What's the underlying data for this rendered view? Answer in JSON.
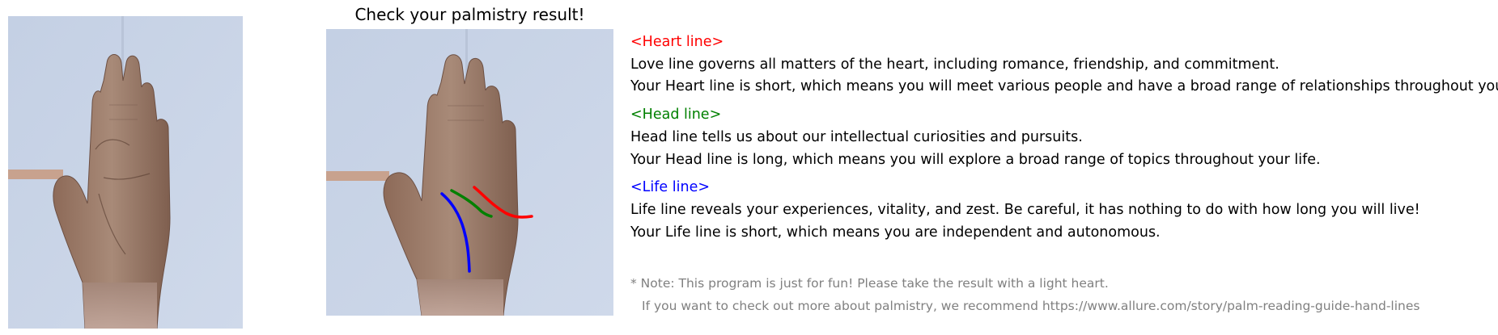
{
  "result_title": "Check your palmistry result!",
  "palm_lines": [
    {
      "name": "Heart line",
      "color": "#ff0000"
    },
    {
      "name": "Head line",
      "color": "#008000"
    },
    {
      "name": "Life line",
      "color": "#0000ff"
    }
  ],
  "sections": {
    "heart": {
      "heading": "<Heart line>",
      "description": "Love line governs all matters of the heart, including romance, friendship, and commitment.",
      "result": "Your Heart line is short, which means you will meet various people and have a broad range of relationships throughout your life.",
      "color": "#ff0000"
    },
    "head": {
      "heading": "<Head line>",
      "description": "Head line tells us about our intellectual curiosities and pursuits.",
      "result": "Your Head line is long, which means you will explore a broad range of topics throughout your life.",
      "color": "#008000"
    },
    "life": {
      "heading": "<Life line>",
      "description": "Life line reveals your experiences, vitality, and zest. Be careful, it has nothing to do with how long you will live!",
      "result": "Your Life line is short, which means you are independent and autonomous.",
      "color": "#0000ff"
    }
  },
  "note": {
    "line1": "* Note: This program is just for fun! Please take the result with a light heart.",
    "line2": "If you want to check out more about palmistry, we recommend https://www.allure.com/story/palm-reading-guide-hand-lines",
    "color": "#808080"
  }
}
